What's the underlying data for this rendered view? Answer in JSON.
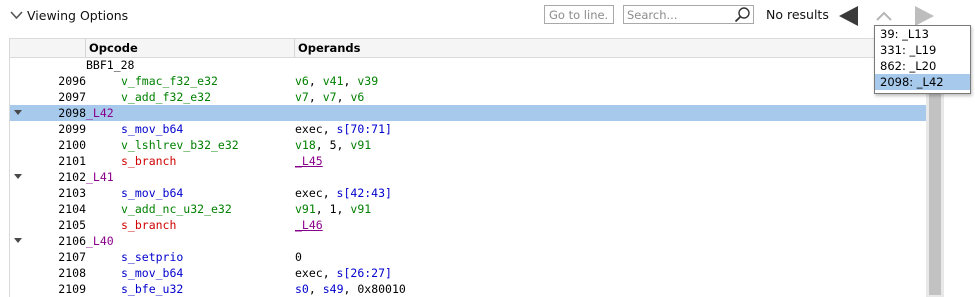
{
  "toolbar": {
    "viewing_options_label": "Viewing Options",
    "goto_placeholder": "Go to line...",
    "search_placeholder": "Search...",
    "no_results": "No results"
  },
  "columns": {
    "opcode": "Opcode",
    "operands": "Operands"
  },
  "block_label": "BBF1_28",
  "rows": [
    {
      "line": "2096",
      "opcode": "v_fmac_f32_e32",
      "kind": "valu",
      "operands": [
        {
          "t": "v6",
          "c": "reg-v"
        },
        {
          "t": ", "
        },
        {
          "t": "v41",
          "c": "reg-v"
        },
        {
          "t": ", "
        },
        {
          "t": "v39",
          "c": "reg-v"
        }
      ]
    },
    {
      "line": "2097",
      "opcode": "v_add_f32_e32",
      "kind": "valu",
      "operands": [
        {
          "t": "v7",
          "c": "reg-v"
        },
        {
          "t": ", "
        },
        {
          "t": "v7",
          "c": "reg-v"
        },
        {
          "t": ", "
        },
        {
          "t": "v6",
          "c": "reg-v"
        }
      ]
    },
    {
      "line": "2098",
      "label": "_L42",
      "collapsible": true,
      "selected": true
    },
    {
      "line": "2099",
      "opcode": "s_mov_b64",
      "kind": "salu",
      "operands": [
        {
          "t": "exec, "
        },
        {
          "t": "s[70:71]",
          "c": "reg-s"
        }
      ]
    },
    {
      "line": "2100",
      "opcode": "v_lshlrev_b32_e32",
      "kind": "valu",
      "operands": [
        {
          "t": "v18",
          "c": "reg-v"
        },
        {
          "t": ", 5, "
        },
        {
          "t": "v91",
          "c": "reg-v"
        }
      ]
    },
    {
      "line": "2101",
      "opcode": "s_branch",
      "kind": "branch",
      "operands": [
        {
          "t": "_L45",
          "c": "lref"
        }
      ]
    },
    {
      "line": "2102",
      "label": "_L41",
      "collapsible": true
    },
    {
      "line": "2103",
      "opcode": "s_mov_b64",
      "kind": "salu",
      "operands": [
        {
          "t": "exec, "
        },
        {
          "t": "s[42:43]",
          "c": "reg-s"
        }
      ]
    },
    {
      "line": "2104",
      "opcode": "v_add_nc_u32_e32",
      "kind": "valu",
      "operands": [
        {
          "t": "v91",
          "c": "reg-v"
        },
        {
          "t": ", 1, "
        },
        {
          "t": "v91",
          "c": "reg-v"
        }
      ]
    },
    {
      "line": "2105",
      "opcode": "s_branch",
      "kind": "branch",
      "operands": [
        {
          "t": "_L46",
          "c": "lref"
        }
      ]
    },
    {
      "line": "2106",
      "label": "_L40",
      "collapsible": true
    },
    {
      "line": "2107",
      "opcode": "s_setprio",
      "kind": "salu",
      "operands": [
        {
          "t": "0"
        }
      ]
    },
    {
      "line": "2108",
      "opcode": "s_mov_b64",
      "kind": "salu",
      "operands": [
        {
          "t": "exec, "
        },
        {
          "t": "s[26:27]",
          "c": "reg-s"
        }
      ]
    },
    {
      "line": "2109",
      "opcode": "s_bfe_u32",
      "kind": "salu",
      "operands": [
        {
          "t": "s0",
          "c": "reg-s"
        },
        {
          "t": ", "
        },
        {
          "t": "s49",
          "c": "reg-s"
        },
        {
          "t": ", 0x80010"
        }
      ]
    }
  ],
  "popup_items": [
    {
      "label": "39: _L13",
      "selected": false
    },
    {
      "label": "331: _L19",
      "selected": false
    },
    {
      "label": "862: _L20",
      "selected": false
    },
    {
      "label": "2098: _L42",
      "selected": true
    }
  ],
  "colors": {
    "selection": "#a6c9ec",
    "valu": "#008000",
    "salu": "#0000cd",
    "branch": "#d00000",
    "label": "#8b008b"
  },
  "icons": {
    "expand": "chevron-down-icon",
    "search": "magnifier-icon",
    "prev": "triangle-left-icon",
    "up": "chevron-up-icon",
    "next": "triangle-right-icon",
    "collapse": "triangle-down-icon"
  }
}
